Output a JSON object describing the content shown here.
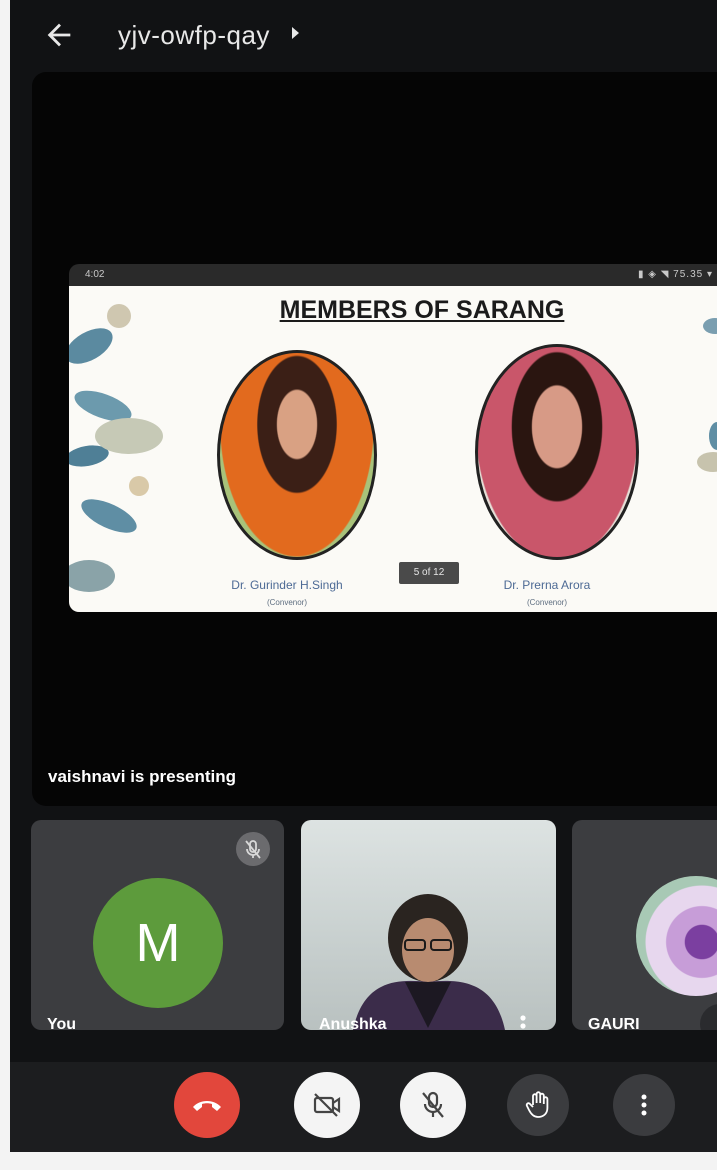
{
  "header": {
    "meeting_code": "yjv-owfp-qay"
  },
  "presentation": {
    "device_status": {
      "time": "4:02",
      "right_status": "▮ ◈ ◥ 75.35 ▾"
    },
    "slide": {
      "title": "MEMBERS OF SARANG",
      "members": [
        {
          "name": "Dr. Gurinder H.Singh",
          "role": "(Convenor)"
        },
        {
          "name": "Dr. Prerna Arora",
          "role": "(Convenor)"
        }
      ],
      "page_indicator": "5 of 12"
    },
    "presenter_text": "vaishnavi is presenting"
  },
  "participants": [
    {
      "label": "You",
      "avatar_letter": "M",
      "avatar_color": "#5d9b3c",
      "muted": true
    },
    {
      "label": "Anushka",
      "video": true
    },
    {
      "label": "GAURI"
    }
  ],
  "controls": {
    "end_call_color": "#e2473c",
    "items": [
      "end-call-icon",
      "camera-off-icon",
      "mic-off-icon",
      "raise-hand-icon",
      "more-vert-icon"
    ]
  }
}
